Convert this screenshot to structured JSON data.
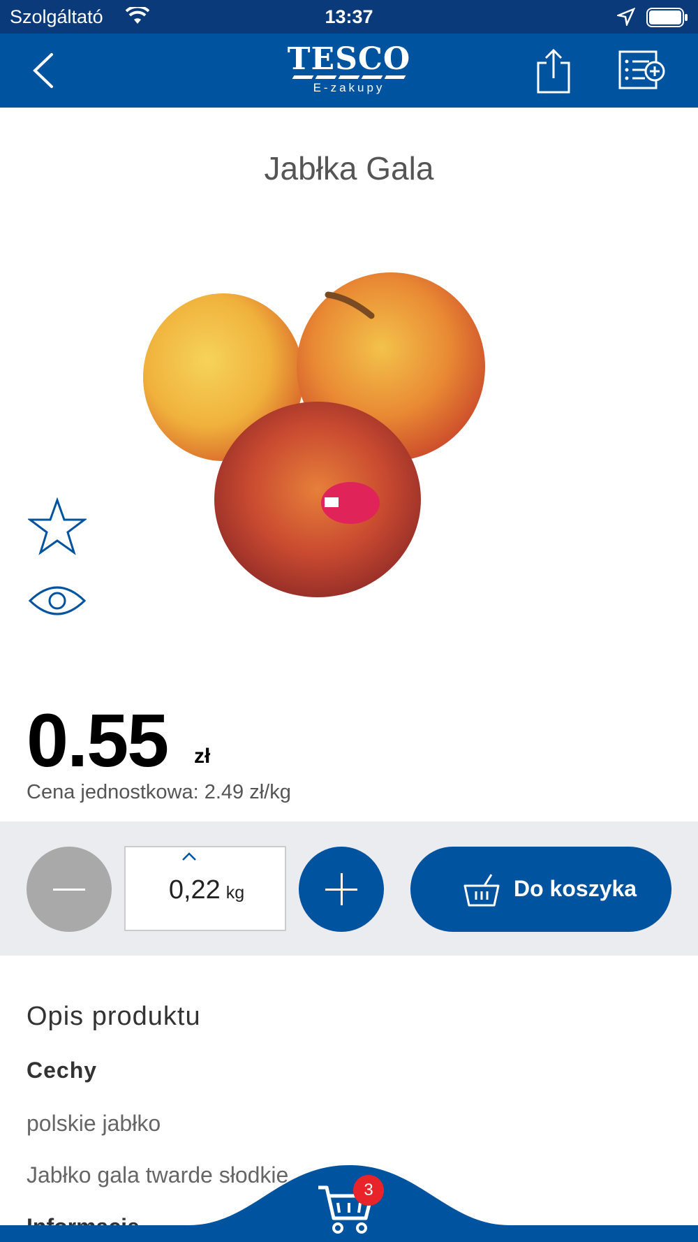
{
  "status_bar": {
    "carrier": "Szolgáltató",
    "time": "13:37"
  },
  "header": {
    "logo_word": "TESCO",
    "logo_sub": "E-zakupy",
    "color": "#00539f"
  },
  "product": {
    "title": "Jabłka Gala",
    "image_icon": "apple-photo",
    "price_value": "0.55",
    "price_currency": "zł",
    "unit_price": "Cena jednostkowa: 2.49 zł/kg"
  },
  "quantity": {
    "value": "0,22",
    "unit": "kg"
  },
  "add_to_cart": {
    "label": "Do koszyka"
  },
  "description": {
    "heading": "Opis produktu",
    "subheading": "Cechy",
    "line1": "polskie jabłko",
    "line2": "Jabłko gala twarde słodkie",
    "line3": "Informacje"
  },
  "cart": {
    "badge_count": "3",
    "badge_color": "#e8232a"
  }
}
